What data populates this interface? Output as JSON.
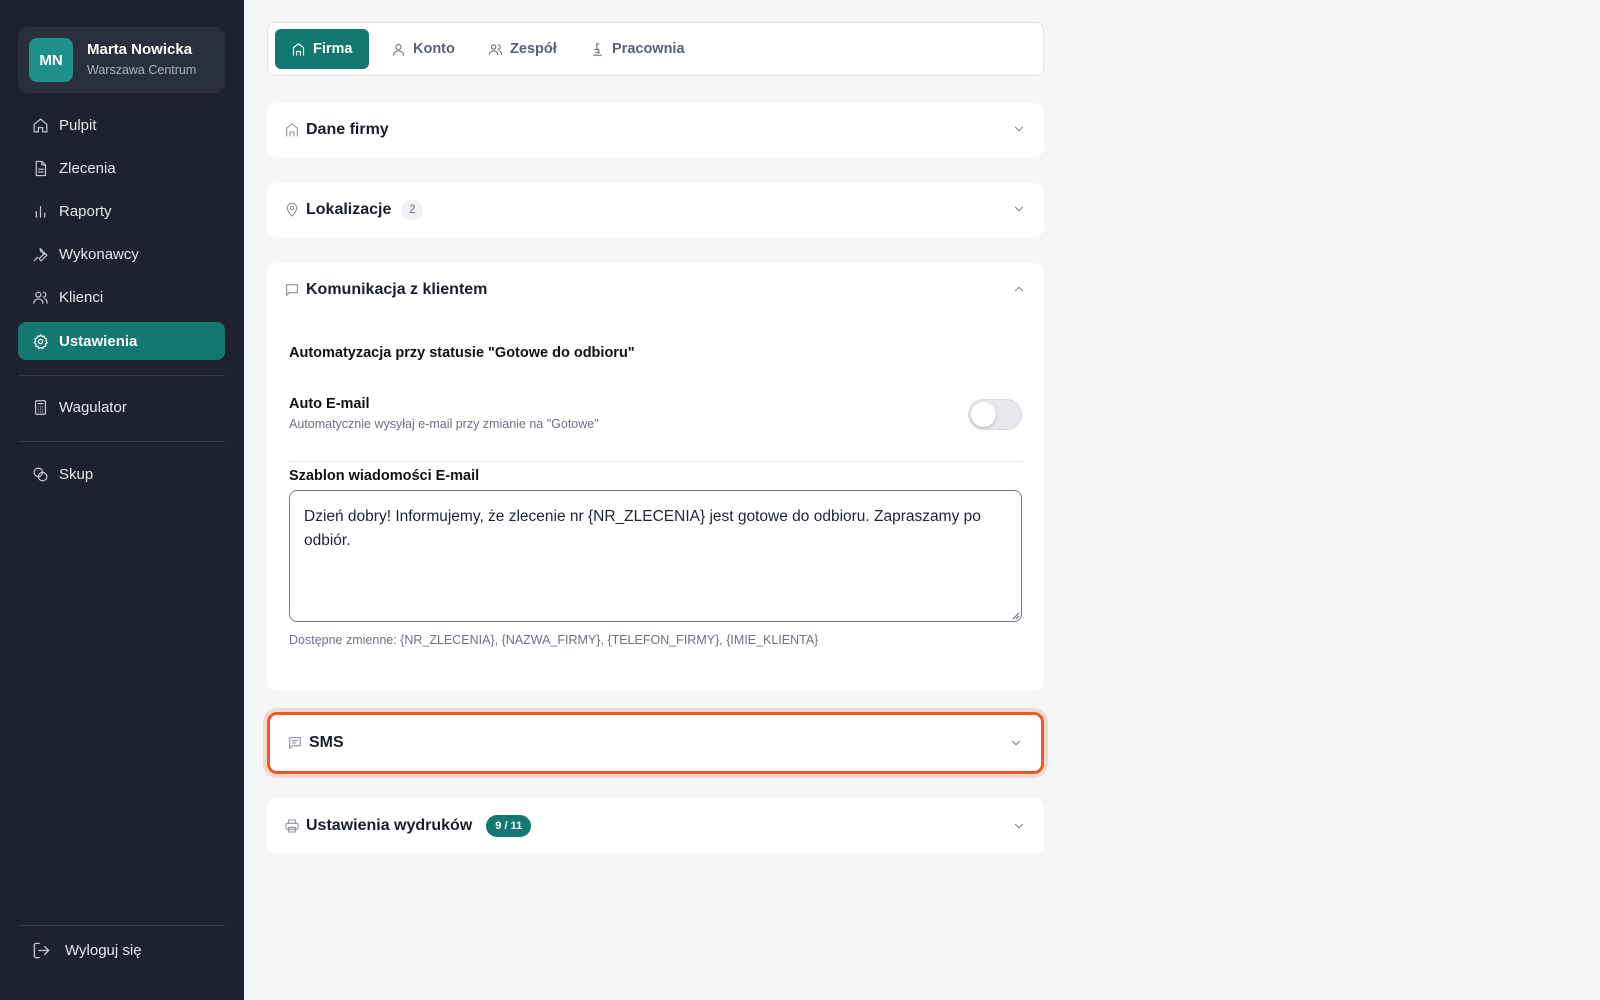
{
  "user": {
    "initials": "MN",
    "name": "Marta Nowicka",
    "location": "Warszawa Centrum"
  },
  "sidebar": {
    "items": [
      {
        "label": "Pulpit",
        "icon": "home-icon"
      },
      {
        "label": "Zlecenia",
        "icon": "document-icon"
      },
      {
        "label": "Raporty",
        "icon": "bar-chart-icon"
      },
      {
        "label": "Wykonawcy",
        "icon": "wrench-icon"
      },
      {
        "label": "Klienci",
        "icon": "users-icon"
      },
      {
        "label": "Ustawienia",
        "icon": "gear-icon",
        "active": true
      }
    ],
    "extra1": {
      "label": "Wagulator",
      "icon": "calculator-icon"
    },
    "extra2": {
      "label": "Skup",
      "icon": "coins-icon"
    },
    "logout": "Wyloguj się"
  },
  "tabs": [
    {
      "label": "Firma",
      "icon": "building-icon",
      "active": true
    },
    {
      "label": "Konto",
      "icon": "user-icon"
    },
    {
      "label": "Zespół",
      "icon": "users-icon"
    },
    {
      "label": "Pracownia",
      "icon": "microscope-icon"
    }
  ],
  "sections": {
    "dane_firmy": {
      "title": "Dane firmy"
    },
    "lokalizacje": {
      "title": "Lokalizacje",
      "count": "2"
    },
    "komunikacja": {
      "title": "Komunikacja z klientem",
      "automation_title": "Automatyzacja przy statusie \"Gotowe do odbioru\"",
      "auto_email_title": "Auto E-mail",
      "auto_email_desc": "Automatycznie wysyłaj e-mail przy zmianie na \"Gotowe\"",
      "auto_email_enabled": false,
      "template_label": "Szablon wiadomości E-mail",
      "template_value": "Dzień dobry! Informujemy, że zlecenie nr {NR_ZLECENIA} jest gotowe do odbioru. Zapraszamy po odbiór.",
      "variables": "Dostępne zmienne: {NR_ZLECENIA}, {NAZWA_FIRMY}, {TELEFON_FIRMY}, {IMIE_KLIENTA}"
    },
    "sms": {
      "title": "SMS"
    },
    "wydruki": {
      "title": "Ustawienia wydruków",
      "badge": "9 / 11"
    }
  },
  "colors": {
    "accent": "#13786f",
    "sidebar_bg": "#1e2230",
    "highlight": "#ea5a26"
  }
}
